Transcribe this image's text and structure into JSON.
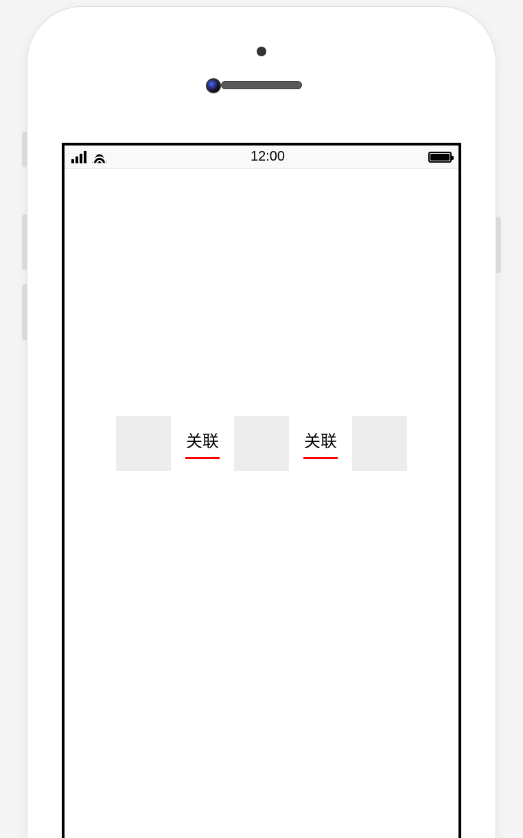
{
  "status_bar": {
    "time": "12:00"
  },
  "links": [
    {
      "label": "关联"
    },
    {
      "label": "关联"
    }
  ]
}
